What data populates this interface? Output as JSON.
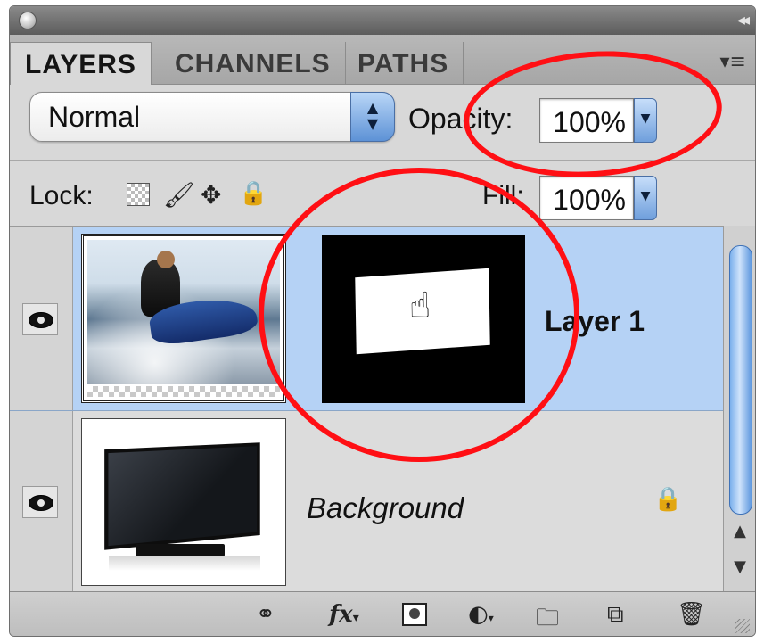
{
  "tabs": [
    {
      "label": "LAYERS",
      "active": true
    },
    {
      "label": "CHANNELS",
      "active": false
    },
    {
      "label": "PATHS",
      "active": false
    }
  ],
  "icons": {
    "close": "close-dot-icon",
    "collapse": "double-chevron-icon",
    "panel_menu": "panel-menu-icon",
    "visibility": "eye-icon",
    "hand": "hand-cursor-icon",
    "lock": "padlock-icon"
  },
  "blend_mode": {
    "value": "Normal",
    "arrows": "▲▼"
  },
  "opacity": {
    "label": "Opacity:",
    "value": "100%"
  },
  "lock": {
    "label": "Lock:"
  },
  "fill": {
    "label": "Fill:",
    "value": "100%"
  },
  "layers": [
    {
      "name": "Layer 1",
      "selected": true,
      "has_mask": true
    },
    {
      "name": "Background",
      "selected": false,
      "locked": true
    }
  ],
  "colors": {
    "selection": "#b5d2f5",
    "annotation": "#ff0f14",
    "accent": "#5d92d6"
  }
}
